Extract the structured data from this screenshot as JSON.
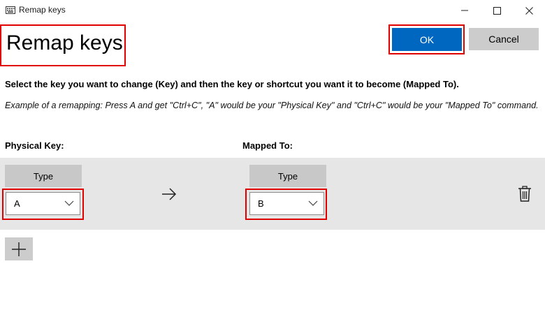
{
  "window": {
    "title": "Remap keys",
    "controls": [
      "minimize-icon",
      "maximize-icon",
      "close-icon"
    ]
  },
  "header": {
    "title": "Remap keys",
    "ok_label": "OK",
    "cancel_label": "Cancel"
  },
  "instructions": "Select the key you want to change (Key) and then the key or shortcut you want it to become (Mapped To).",
  "example": "Example of a remapping: Press A and get \"Ctrl+C\", \"A\" would be your \"Physical Key\" and \"Ctrl+C\" would be your \"Mapped To\" command.",
  "columns": {
    "physical": "Physical Key:",
    "mapped": "Mapped To:"
  },
  "mappings": [
    {
      "physical": {
        "type_label": "Type",
        "value": "A"
      },
      "mapped": {
        "type_label": "Type",
        "value": "B"
      }
    }
  ],
  "colors": {
    "accent": "#0067c0",
    "highlight": "#e00000",
    "row_bg": "#e6e6e6",
    "button_bg": "#cccccc"
  }
}
